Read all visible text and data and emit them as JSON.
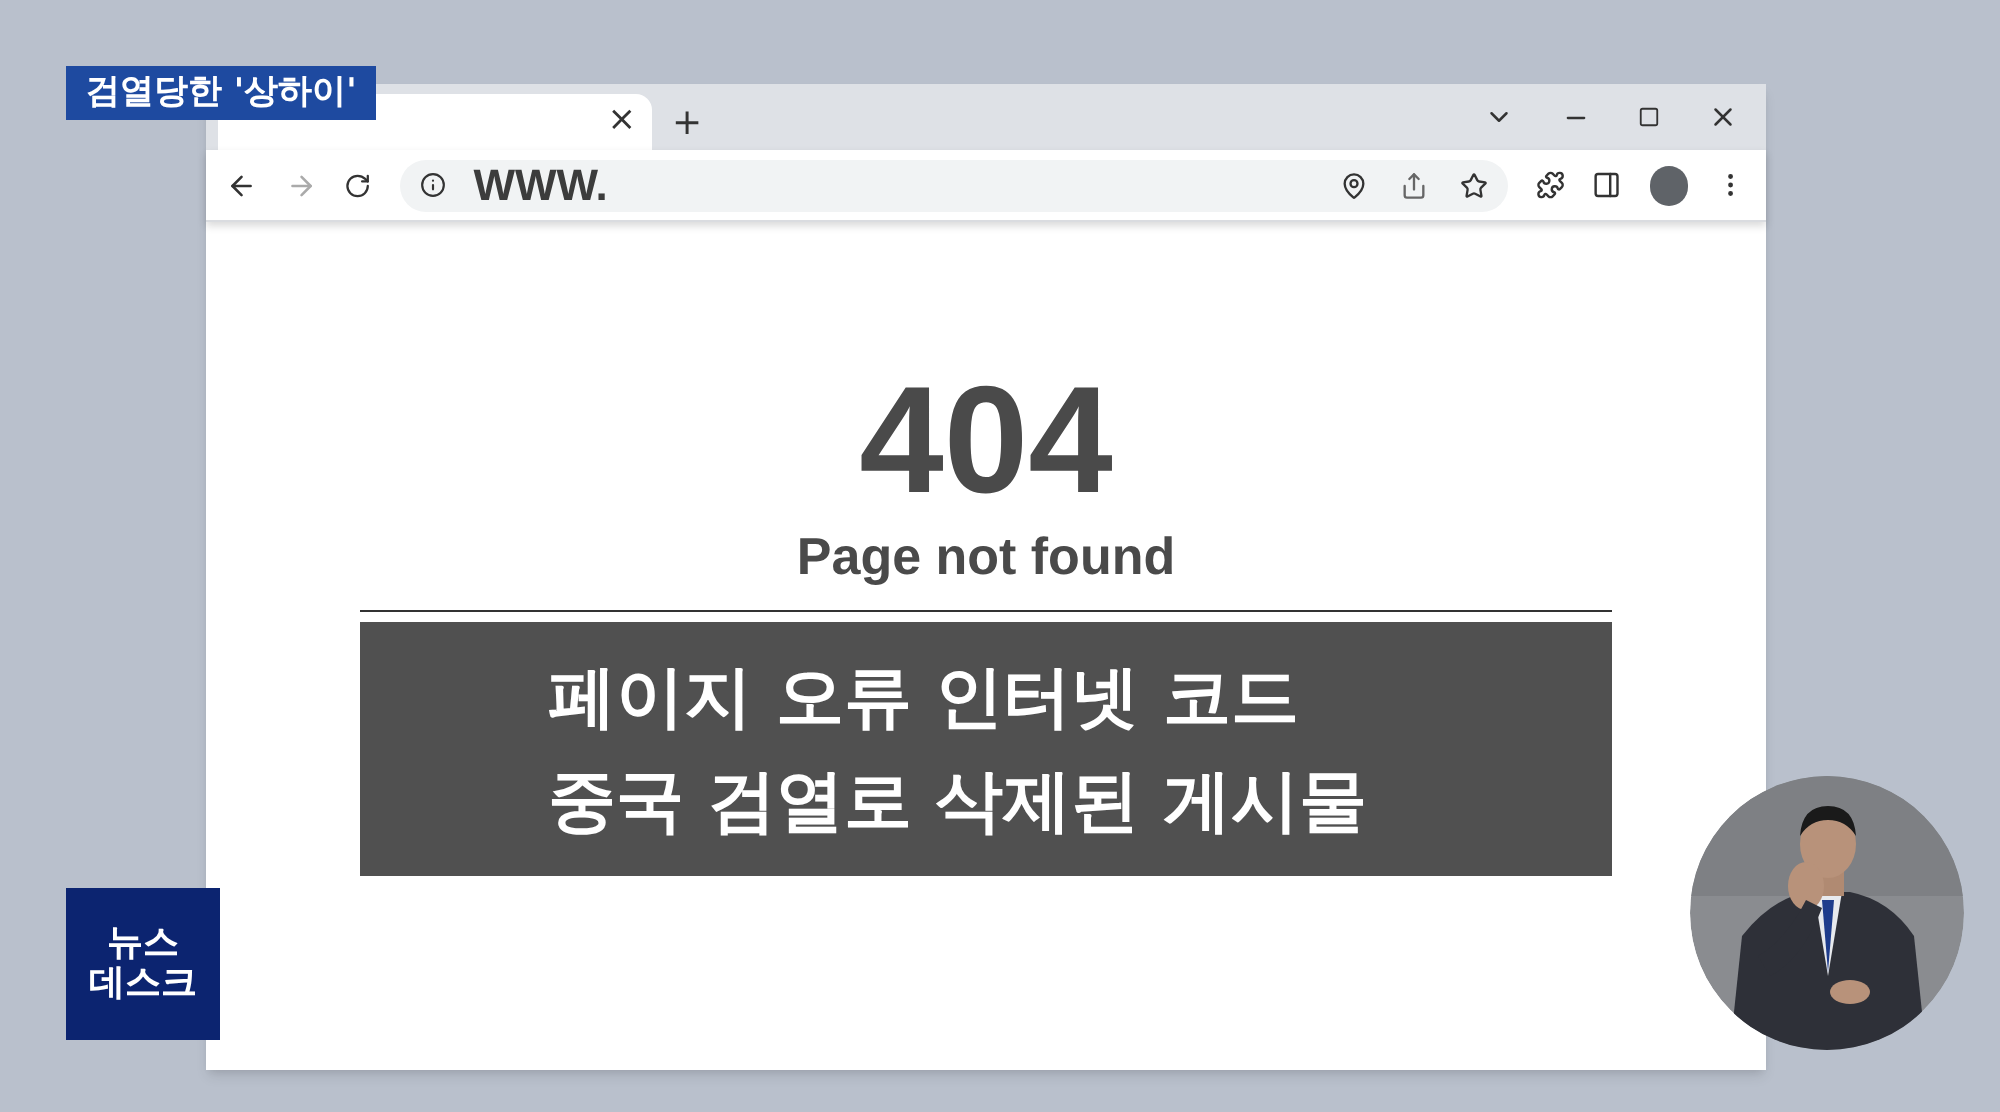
{
  "caption": "검열당한 '상하이'",
  "browser": {
    "tabs": [
      {
        "close": "×",
        "selected": true
      }
    ],
    "new_tab": "+",
    "address": "WWW."
  },
  "page": {
    "code": "404",
    "message": "Page not found",
    "notes": [
      "페이지 오류 인터넷 코드",
      "중국 검열로 삭제된 게시물"
    ]
  },
  "show_logo": {
    "lines": [
      "뉴스",
      "데스크"
    ]
  }
}
